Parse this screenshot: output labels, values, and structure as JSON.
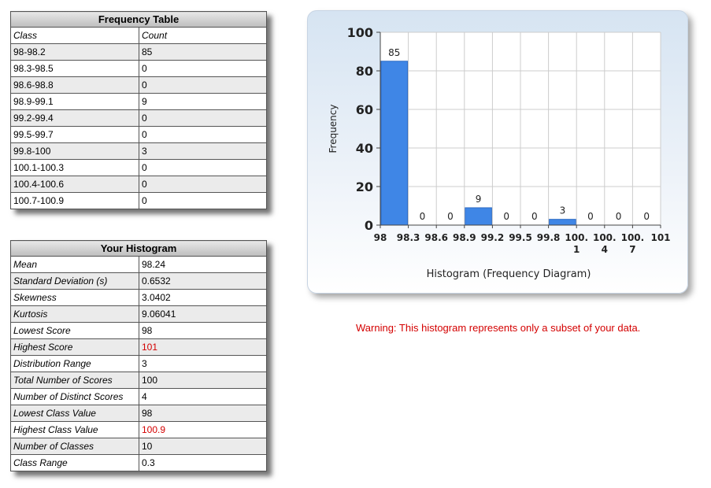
{
  "frequency_table": {
    "title": "Frequency Table",
    "col_class": "Class",
    "col_count": "Count",
    "rows": [
      {
        "cls": "98-98.2",
        "count": "85"
      },
      {
        "cls": "98.3-98.5",
        "count": "0"
      },
      {
        "cls": "98.6-98.8",
        "count": "0"
      },
      {
        "cls": "98.9-99.1",
        "count": "9"
      },
      {
        "cls": "99.2-99.4",
        "count": "0"
      },
      {
        "cls": "99.5-99.7",
        "count": "0"
      },
      {
        "cls": "99.8-100",
        "count": "3"
      },
      {
        "cls": "100.1-100.3",
        "count": "0"
      },
      {
        "cls": "100.4-100.6",
        "count": "0"
      },
      {
        "cls": "100.7-100.9",
        "count": "0"
      }
    ]
  },
  "histogram_stats": {
    "title": "Your Histogram",
    "rows": [
      {
        "label": "Mean",
        "value": "98.24"
      },
      {
        "label": "Standard Deviation (s)",
        "value": "0.6532"
      },
      {
        "label": "Skewness",
        "value": "3.0402"
      },
      {
        "label": "Kurtosis",
        "value": "9.06041"
      },
      {
        "label": "Lowest Score",
        "value": "98"
      },
      {
        "label": "Highest Score",
        "value": "101",
        "highlight": true
      },
      {
        "label": "Distribution Range",
        "value": "3"
      },
      {
        "label": "Total Number of Scores",
        "value": "100"
      },
      {
        "label": "Number of Distinct Scores",
        "value": "4"
      },
      {
        "label": "Lowest Class Value",
        "value": "98"
      },
      {
        "label": "Highest Class Value",
        "value": "100.9",
        "highlight": true
      },
      {
        "label": "Number of Classes",
        "value": "10"
      },
      {
        "label": "Class Range",
        "value": "0.3"
      }
    ]
  },
  "chart_data": {
    "type": "bar",
    "title": "",
    "xlabel": "Histogram (Frequency Diagram)",
    "ylabel": "Frequency",
    "ylim": [
      0,
      100
    ],
    "yticks": [
      0,
      20,
      40,
      60,
      80,
      100
    ],
    "xtick_labels": [
      [
        "98"
      ],
      [
        "98.3"
      ],
      [
        "98.6"
      ],
      [
        "98.9"
      ],
      [
        "99.2"
      ],
      [
        "99.5"
      ],
      [
        "99.8"
      ],
      [
        "100.",
        "1"
      ],
      [
        "100.",
        "4"
      ],
      [
        "100.",
        "7"
      ],
      [
        "101"
      ]
    ],
    "values": [
      85,
      0,
      0,
      9,
      0,
      0,
      3,
      0,
      0,
      0
    ],
    "bar_color": "#3f86e6",
    "grid": true
  },
  "warning_text": "Warning: This histogram represents only a subset of your data."
}
